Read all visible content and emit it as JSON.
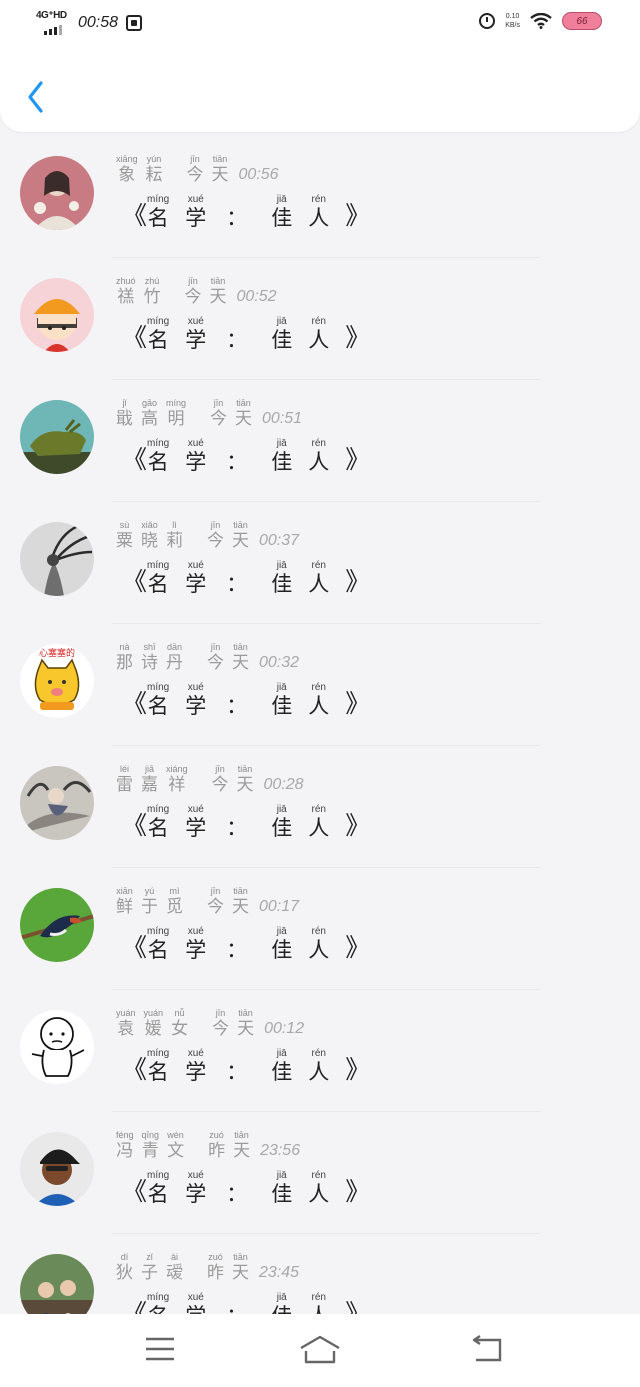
{
  "status_bar": {
    "network": "4G⁺HD",
    "time": "00:58",
    "speed_line1": "0.10",
    "speed_line2": "KB/s",
    "battery": "66"
  },
  "colors": {
    "accent": "#2196f3",
    "battery_fill": "#ef7f9a",
    "background": "#f4f4f6"
  },
  "post_title": [
    {
      "py": "míng",
      "hz": "名"
    },
    {
      "py": "xué",
      "hz": "学"
    },
    {
      "py": "jiā",
      "hz": "佳"
    },
    {
      "py": "rén",
      "hz": "人"
    }
  ],
  "title_open": "《",
  "title_close": "》",
  "title_colon": "：",
  "items": [
    {
      "avatar": "woman-with-flowers-avatar",
      "name": [
        {
          "py": "xiāng",
          "hz": "象"
        },
        {
          "py": "yún",
          "hz": "耘"
        }
      ],
      "day": [
        {
          "py": "jīn",
          "hz": "今"
        },
        {
          "py": "tiān",
          "hz": "天"
        }
      ],
      "time": "00:56"
    },
    {
      "avatar": "chibi-maruko-avatar",
      "name": [
        {
          "py": "zhuó",
          "hz": "禚"
        },
        {
          "py": "zhú",
          "hz": "竹"
        }
      ],
      "day": [
        {
          "py": "jīn",
          "hz": "今"
        },
        {
          "py": "tiān",
          "hz": "天"
        }
      ],
      "time": "00:52"
    },
    {
      "avatar": "bronze-ox-statue-avatar",
      "name": [
        {
          "py": "jǐ",
          "hz": "戢"
        },
        {
          "py": "gāo",
          "hz": "高"
        },
        {
          "py": "míng",
          "hz": "明"
        }
      ],
      "day": [
        {
          "py": "jīn",
          "hz": "今"
        },
        {
          "py": "tiān",
          "hz": "天"
        }
      ],
      "time": "00:51"
    },
    {
      "avatar": "windblown-hair-avatar",
      "name": [
        {
          "py": "sù",
          "hz": "粟"
        },
        {
          "py": "xiǎo",
          "hz": "晓"
        },
        {
          "py": "lì",
          "hz": "莉"
        }
      ],
      "day": [
        {
          "py": "jīn",
          "hz": "今"
        },
        {
          "py": "tiān",
          "hz": "天"
        }
      ],
      "time": "00:37"
    },
    {
      "avatar": "yellow-cat-cartoon-avatar",
      "name": [
        {
          "py": "nà",
          "hz": "那"
        },
        {
          "py": "shī",
          "hz": "诗"
        },
        {
          "py": "dān",
          "hz": "丹"
        }
      ],
      "day": [
        {
          "py": "jīn",
          "hz": "今"
        },
        {
          "py": "tiān",
          "hz": "天"
        }
      ],
      "time": "00:32",
      "avatar_caption": "心塞塞的"
    },
    {
      "avatar": "painted-warrior-avatar",
      "name": [
        {
          "py": "léi",
          "hz": "雷"
        },
        {
          "py": "jiā",
          "hz": "嘉"
        },
        {
          "py": "xiáng",
          "hz": "祥"
        }
      ],
      "day": [
        {
          "py": "jīn",
          "hz": "今"
        },
        {
          "py": "tiān",
          "hz": "天"
        }
      ],
      "time": "00:28"
    },
    {
      "avatar": "swallow-bird-avatar",
      "name": [
        {
          "py": "xiān",
          "hz": "鲜"
        },
        {
          "py": "yú",
          "hz": "于"
        },
        {
          "py": "mì",
          "hz": "觅"
        }
      ],
      "day": [
        {
          "py": "jīn",
          "hz": "今"
        },
        {
          "py": "tiān",
          "hz": "天"
        }
      ],
      "time": "00:17"
    },
    {
      "avatar": "baby-sketch-avatar",
      "name": [
        {
          "py": "yuán",
          "hz": "袁"
        },
        {
          "py": "yuán",
          "hz": "媛"
        },
        {
          "py": "nǚ",
          "hz": "女"
        }
      ],
      "day": [
        {
          "py": "jīn",
          "hz": "今"
        },
        {
          "py": "tiān",
          "hz": "天"
        }
      ],
      "time": "00:12"
    },
    {
      "avatar": "man-in-cap-avatar",
      "name": [
        {
          "py": "féng",
          "hz": "冯"
        },
        {
          "py": "qīng",
          "hz": "青"
        },
        {
          "py": "wén",
          "hz": "文"
        }
      ],
      "day": [
        {
          "py": "zuó",
          "hz": "昨"
        },
        {
          "py": "tiān",
          "hz": "天"
        }
      ],
      "time": "23:56"
    },
    {
      "avatar": "couple-photo-avatar",
      "name": [
        {
          "py": "dí",
          "hz": "狄"
        },
        {
          "py": "zǐ",
          "hz": "子"
        },
        {
          "py": "ài",
          "hz": "叆"
        }
      ],
      "day": [
        {
          "py": "zuó",
          "hz": "昨"
        },
        {
          "py": "tiān",
          "hz": "天"
        }
      ],
      "time": "23:45"
    }
  ]
}
